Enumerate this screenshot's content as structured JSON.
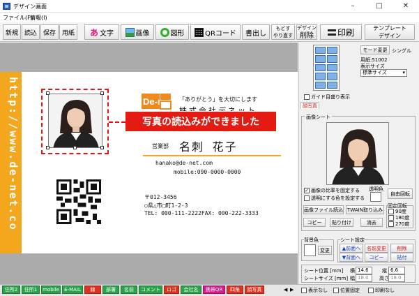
{
  "window": {
    "title": "デザイン画面",
    "minimize": "–",
    "maximize": "□",
    "close": "✕"
  },
  "menu": [
    "ファイル(F)",
    "情報(I)"
  ],
  "toolbar": {
    "new": "新規",
    "read": "読込",
    "save": "保存",
    "paper": "用紙",
    "text": "文字",
    "image": "画像",
    "shape": "図形",
    "qr": "QRコード",
    "export": "書出し",
    "undo": "もどす",
    "redo": "やり直す",
    "design_del_top": "デザイン",
    "design_del_bottom": "削除",
    "print": "印刷",
    "template_top": "テンプレート",
    "template_bottom": "デザイン"
  },
  "card": {
    "url": "http://www.de-net.co",
    "banner": "写真の読込みができました",
    "logo": "De-net",
    "tagline": "「ありがとう」を大切にします",
    "company": "株式会社デネット",
    "dept": "営業部",
    "name": "名刺  花子",
    "email": "hanako@de-net.com",
    "mobile": "mobile:090-0000-0000",
    "zip": "〒012-3456",
    "address": "○県△市□町1-2-3",
    "tel": "TEL: 000-111-2222FAX: 000-222-3333"
  },
  "panel": {
    "mode_label": "モード変更",
    "mode_value": "シングル",
    "paper": "用紙:51002",
    "display_size_label": "表示サイズ",
    "display_size_value": "標準サイズ",
    "guide": "ガイド目盛り表示",
    "photo_tab": "顔写真",
    "image_sheet": "画像シート",
    "keep_ratio": "画像の比率を固定する",
    "transparent": "透明にする色を設定する",
    "transparent_color": "透明色",
    "free_rotate": "自由回転",
    "load_file": "画像ファイル読込",
    "twain": "TWAIN取り込み",
    "copy": "コピー",
    "paste": "貼り付け",
    "erase": "消去",
    "fixed_rotate": "固定回転",
    "rot90": "90度",
    "rot180": "180度",
    "rot270": "270度",
    "bg_color": "背景色",
    "change": "変更",
    "sheet_settings": "シート設定",
    "to_front": "▲前面へ",
    "name_change": "名前変更",
    "delete": "削除",
    "to_back": "▼背面へ",
    "copy2": "コピー",
    "paste2": "貼付",
    "sheet_pos": "シート位置 [mm]",
    "sheet_size": "シートサイズ [mm]",
    "horiz": "横",
    "vert": "縦",
    "width": "幅",
    "height": "高さ",
    "pos_x": "14.6",
    "pos_y": "6.6",
    "size_w": "18.0",
    "size_h": "18.0",
    "hide": "表示なし",
    "fix_pos": "位置固定",
    "no_print": "印刷なし"
  },
  "chips": [
    {
      "label": "住所2",
      "color": "#2aa24a"
    },
    {
      "label": "住所1",
      "color": "#2aa24a"
    },
    {
      "label": "mobile",
      "color": "#2aa24a"
    },
    {
      "label": "E-MAIL",
      "color": "#2aa24a"
    },
    {
      "label": "線",
      "color": "#e0301e"
    },
    {
      "label": "部署",
      "color": "#2aa24a"
    },
    {
      "label": "名前",
      "color": "#2aa24a"
    },
    {
      "label": "コメント",
      "color": "#2aa24a"
    },
    {
      "label": "ロゴ",
      "color": "#e0301e"
    },
    {
      "label": "会社名",
      "color": "#2aa24a"
    },
    {
      "label": "携帯QR",
      "color": "#d9188c"
    },
    {
      "label": "四角",
      "color": "#e0301e"
    },
    {
      "label": "顔写真",
      "color": "#e0301e"
    }
  ]
}
